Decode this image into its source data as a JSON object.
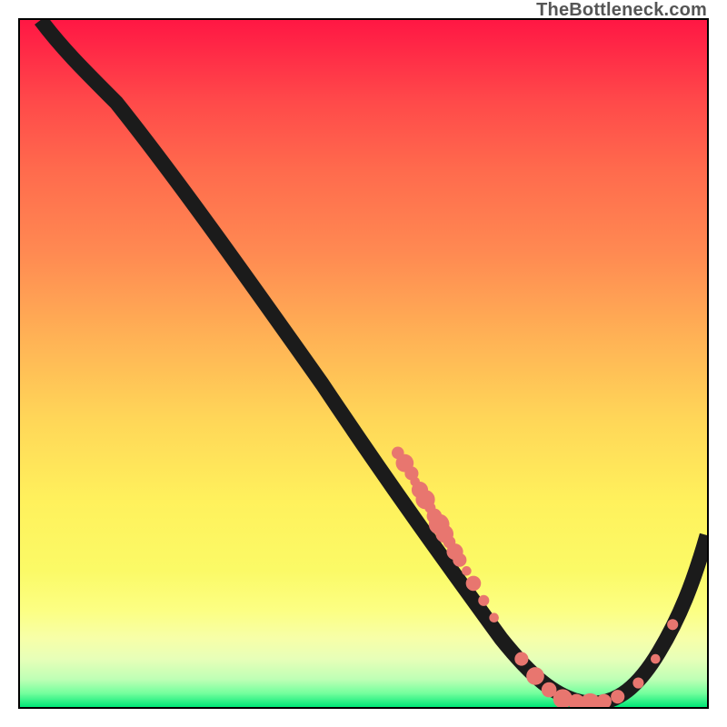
{
  "watermark": "TheBottleneck.com",
  "chart_data": {
    "type": "line",
    "title": "",
    "xlabel": "",
    "ylabel": "",
    "xlim": [
      0,
      100
    ],
    "ylim": [
      0,
      100
    ],
    "series": [
      {
        "name": "curve",
        "x": [
          3,
          8,
          14,
          22,
          36,
          50,
          62,
          68,
          74,
          80,
          86,
          92,
          100
        ],
        "y": [
          100,
          97,
          91,
          80,
          60,
          40,
          22,
          12,
          4,
          0,
          0,
          4,
          25
        ]
      }
    ],
    "dot_clusters": [
      {
        "name": "left-band",
        "x_range": [
          55,
          64
        ],
        "y_range": [
          23,
          40
        ],
        "count": 18,
        "r_range": [
          4,
          11
        ]
      },
      {
        "name": "valley",
        "x_range": [
          72,
          88
        ],
        "y_range": [
          0,
          4
        ],
        "count": 10,
        "r_range": [
          5,
          12
        ]
      },
      {
        "name": "right-rise",
        "x_range": [
          90,
          95
        ],
        "y_range": [
          7,
          15
        ],
        "count": 3,
        "r_range": [
          5,
          8
        ]
      }
    ],
    "colors": {
      "curve": "#1b1b1b",
      "dot": "#e8766f",
      "gradient_top": "#ff1744",
      "gradient_mid": "#fff15c",
      "gradient_bottom": "#00e676",
      "frame": "#000000",
      "watermark": "#555555"
    }
  }
}
